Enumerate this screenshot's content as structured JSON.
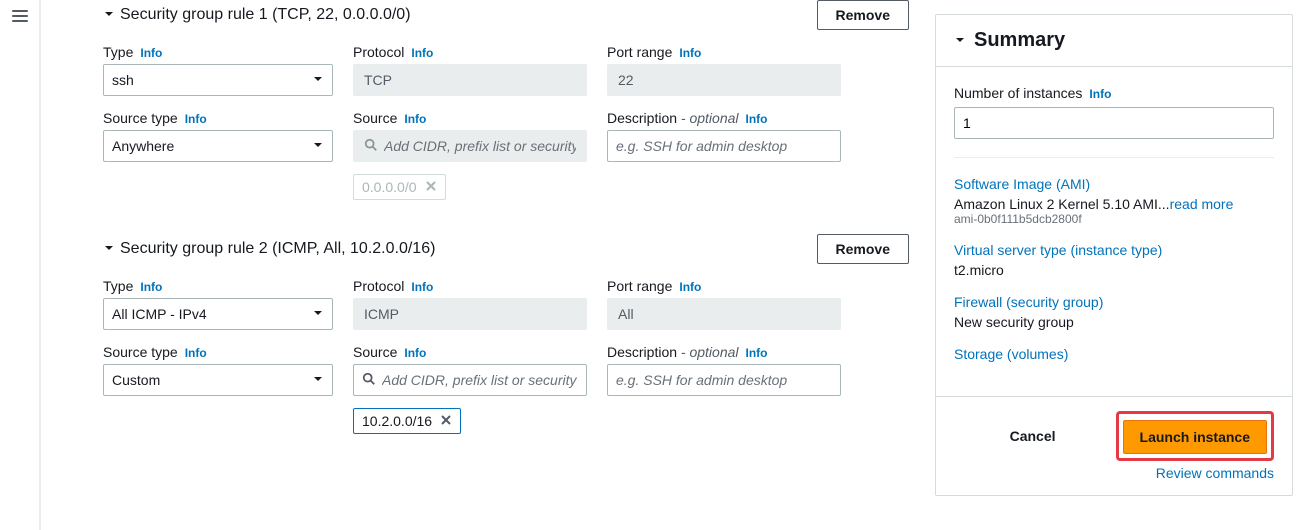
{
  "labels": {
    "type": "Type",
    "protocol": "Protocol",
    "port_range": "Port range",
    "source_type": "Source type",
    "source": "Source",
    "description": "Description",
    "optional": "- optional",
    "info": "Info",
    "remove": "Remove",
    "source_placeholder": "Add CIDR, prefix list or security",
    "desc_placeholder": "e.g. SSH for admin desktop"
  },
  "rules": [
    {
      "title": "Security group rule 1 (TCP, 22, 0.0.0.0/0)",
      "type": "ssh",
      "protocol": "TCP",
      "port_range": "22",
      "source_type": "Anywhere",
      "source_disabled": true,
      "chips": [
        {
          "text": "0.0.0.0/0",
          "state": "disabled"
        }
      ]
    },
    {
      "title": "Security group rule 2 (ICMP, All, 10.2.0.0/16)",
      "type": "All ICMP - IPv4",
      "protocol": "ICMP",
      "port_range": "All",
      "source_type": "Custom",
      "source_disabled": false,
      "chips": [
        {
          "text": "10.2.0.0/16",
          "state": "active"
        }
      ]
    }
  ],
  "summary": {
    "title": "Summary",
    "instances_label": "Number of instances",
    "instances_value": "1",
    "ami_label": "Software Image (AMI)",
    "ami_text": "Amazon Linux 2 Kernel 5.10 AMI...",
    "ami_more": "read more",
    "ami_id": "ami-0b0f111b5dcb2800f",
    "type_label": "Virtual server type (instance type)",
    "type_value": "t2.micro",
    "firewall_label": "Firewall (security group)",
    "firewall_value": "New security group",
    "storage_label": "Storage (volumes)",
    "cancel": "Cancel",
    "launch": "Launch instance",
    "review": "Review commands"
  }
}
